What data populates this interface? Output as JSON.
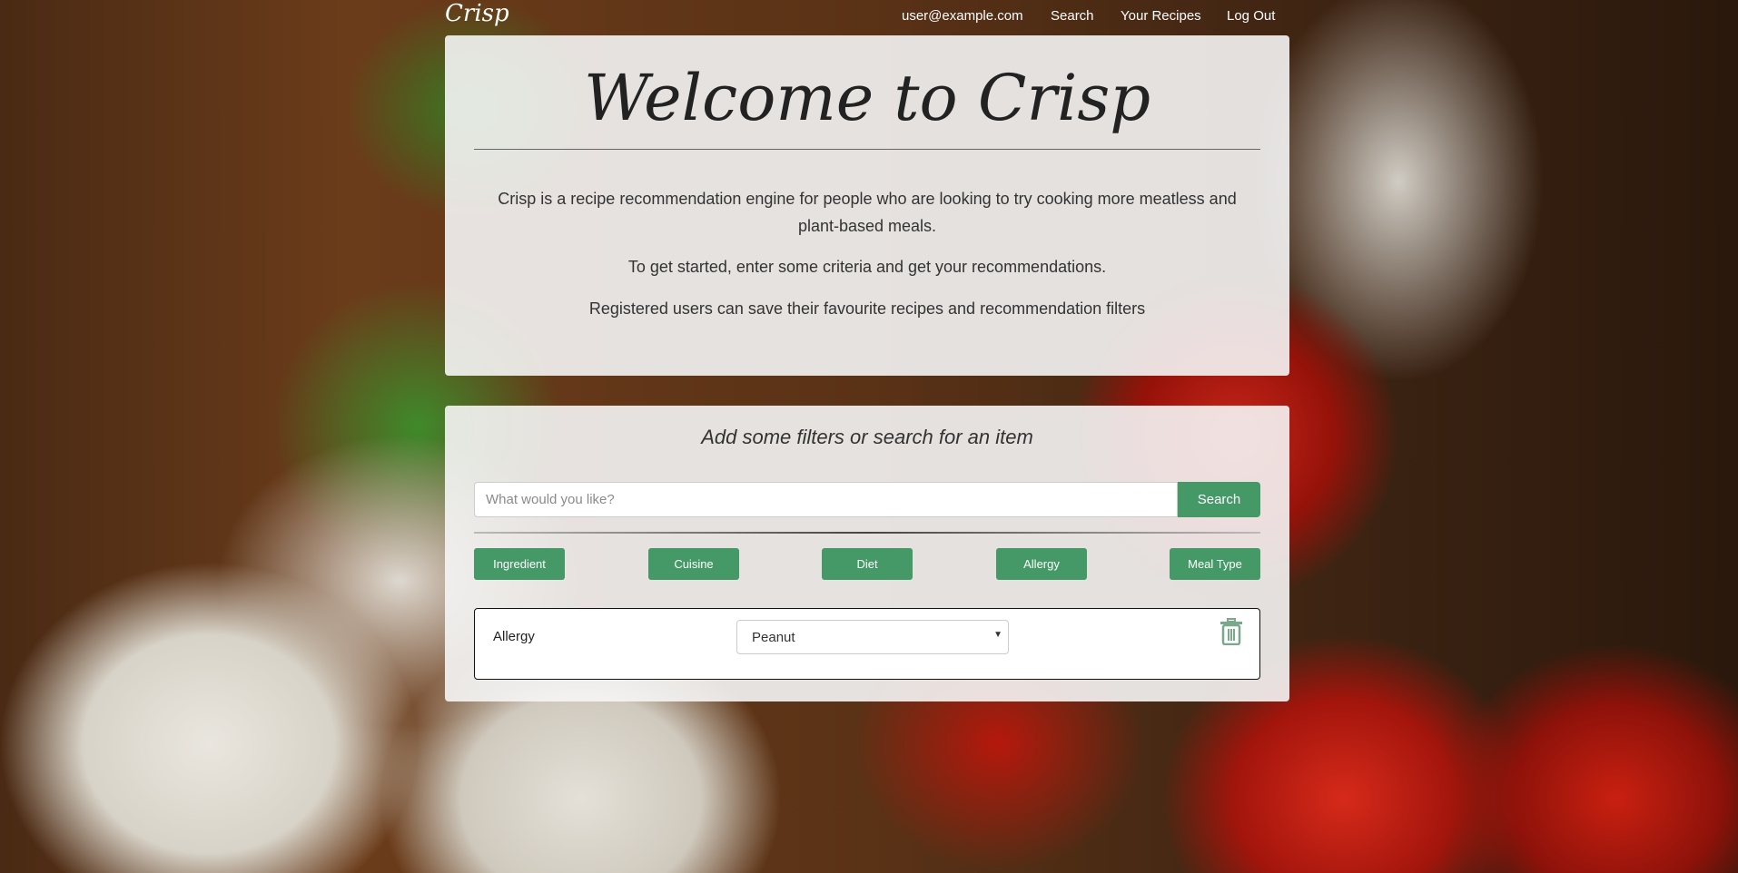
{
  "nav": {
    "logo": "Crisp",
    "user": "user@example.com",
    "search": "Search",
    "recipes": "Your Recipes",
    "logout": "Log Out"
  },
  "welcome": {
    "title": "Welcome to Crisp",
    "p1": "Crisp is a recipe recommendation engine for people who are looking to try cooking more meatless and plant-based meals.",
    "p2": "To get started, enter some criteria and get your recommendations.",
    "p3": "Registered users can save their favourite recipes and recommendation filters"
  },
  "search": {
    "heading": "Add some filters or search for an item",
    "placeholder": "What would you like?",
    "value": "",
    "button": "Search"
  },
  "filters": [
    "Ingredient",
    "Cuisine",
    "Diet",
    "Allergy",
    "Meal Type"
  ],
  "active_filter": {
    "label": "Allergy",
    "selected": "Peanut",
    "delete_icon": "trash-icon"
  },
  "colors": {
    "accent": "#449966"
  }
}
